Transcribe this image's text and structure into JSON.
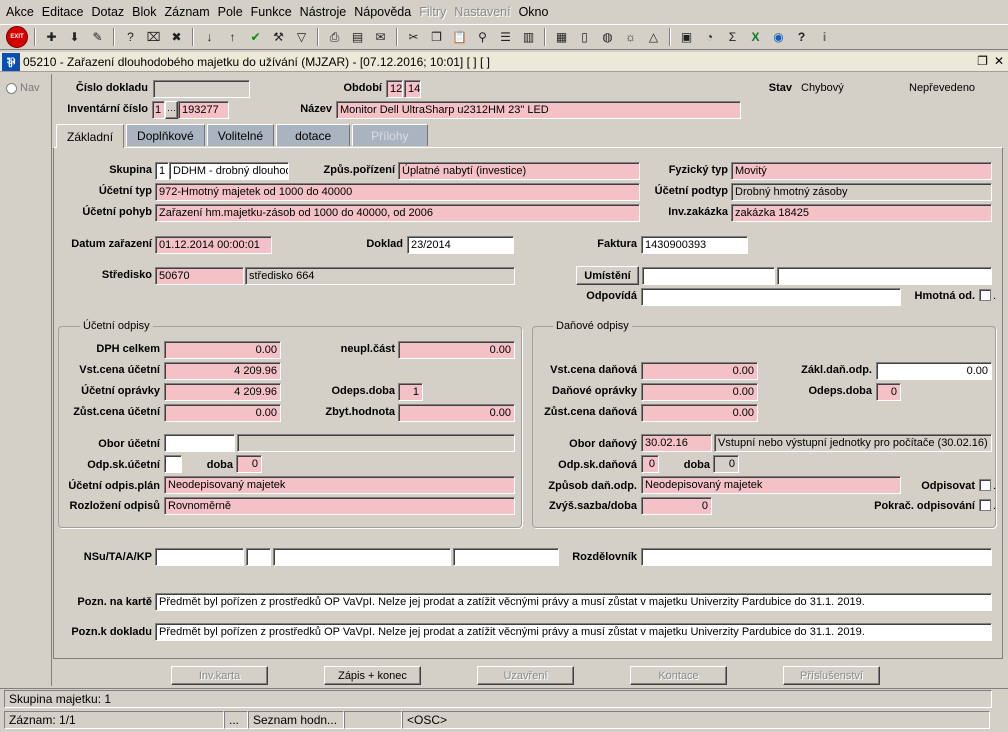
{
  "menu": [
    "Akce",
    "Editace",
    "Dotaz",
    "Blok",
    "Záznam",
    "Pole",
    "Funkce",
    "Nástroje",
    "Nápověda",
    "Filtry",
    "Nastavení",
    "Okno"
  ],
  "menu_disabled": [
    "Filtry",
    "Nastavení"
  ],
  "toolbar_icons": [
    "exit-icon",
    "add-record-icon",
    "save-icon",
    "erase-icon",
    "query-icon",
    "clear-query-icon",
    "delete-record-icon",
    "sort-asc-icon",
    "sort-desc-icon",
    "checkmark-icon",
    "wrench-icon",
    "filter-icon",
    "print-icon",
    "print-preview-icon",
    "mail-icon",
    "cut-icon",
    "copy-icon",
    "paste-icon",
    "zoom-icon",
    "list-icon",
    "columns-icon",
    "report-icon",
    "document-icon",
    "globe-icon",
    "sun-icon",
    "chart-icon",
    "calculator-icon",
    "report-edit-icon",
    "sum-icon",
    "excel-icon",
    "world-icon",
    "help-icon",
    "info-icon"
  ],
  "window": {
    "title": "05210 - Zařazení dlouhodobého majetku do užívání (MJZAR) - [07.12.2016; 10:01] [ ] [ ]"
  },
  "nav": {
    "label": "Nav"
  },
  "header": {
    "cislo_dokladu_label": "Číslo dokladu",
    "cislo_dokladu": "",
    "obdobi_label": "Období",
    "obdobi_1": "12",
    "obdobi_2": "14",
    "stav_label": "Stav",
    "stav": "Chybový",
    "neprevedeno": "Nepřevedeno",
    "inv_cislo_label": "Inventární číslo",
    "inv_cislo_1": "1",
    "inv_cislo_dots": "···",
    "inv_cislo_2": "193277",
    "nazev_label": "Název",
    "nazev": "Monitor Dell UltraSharp u2312HM 23\" LED"
  },
  "tabs": [
    {
      "label": "Základní",
      "state": "active"
    },
    {
      "label": "Doplňkové",
      "state": "inactive"
    },
    {
      "label": "Volitelné",
      "state": "inactive"
    },
    {
      "label": "dotace",
      "state": "inactive"
    },
    {
      "label": "Přílohy",
      "state": "disabled"
    }
  ],
  "main": {
    "skupina_label": "Skupina",
    "skupina_code": "1",
    "skupina_name": "DDHM - drobný dlouhod",
    "zpus_porizeni_label": "Způs.pořízení",
    "zpus_porizeni": "Úplatné nabytí (investice)",
    "fyzicky_typ_label": "Fyzický typ",
    "fyzicky_typ": "Movitý",
    "ucetni_typ_label": "Účetní typ",
    "ucetni_typ": "972-Hmotný majetek od 1000 do 40000",
    "ucetni_podtyp_label": "Účetní podtyp",
    "ucetni_podtyp": "Drobný hmotný zásoby",
    "ucetni_pohyb_label": "Účetní pohyb",
    "ucetni_pohyb": "Zařazení hm.majetku-zásob od 1000 do 40000, od 2006",
    "inv_zakazka_label": "Inv.zakázka",
    "inv_zakazka": "zakázka 18425",
    "datum_zarazeni_label": "Datum zařazení",
    "datum_zarazeni": "01.12.2014 00:00:01",
    "doklad_label": "Doklad",
    "doklad": "23/2014",
    "faktura_label": "Faktura",
    "faktura": "1430900393",
    "stredisko_label": "Středisko",
    "stredisko_code": "50670",
    "stredisko_name": "středisko 664",
    "umisteni_button": "Umístění",
    "umisteni_1": "",
    "umisteni_2": "",
    "odpovida_label": "Odpovídá",
    "odpovida": "",
    "hmotna_od_label": "Hmotná od."
  },
  "ucetni_odpisy": {
    "title": "Účetní odpisy",
    "dph_celkem_label": "DPH celkem",
    "dph_celkem": "0.00",
    "neupl_cast_label": "neupl.část",
    "neupl_cast": "0.00",
    "vst_cena_label": "Vst.cena účetní",
    "vst_cena": "4 209.96",
    "ucetni_opravky_label": "Účetní oprávky",
    "ucetni_opravky": "4 209.96",
    "odeps_doba_label": "Odeps.doba",
    "odeps_doba": "1",
    "zust_cena_label": "Zůst.cena účetní",
    "zust_cena": "0.00",
    "zbyt_hodnota_label": "Zbyt.hodnota",
    "zbyt_hodnota": "0.00",
    "obor_label": "Obor účetní",
    "obor_code": "",
    "obor_name": "",
    "odp_sk_label": "Odp.sk.účetní",
    "odp_sk": "",
    "doba_label": "doba",
    "doba": "0",
    "plan_label": "Účetní odpis.plán",
    "plan": "Neodepisovaný majetek",
    "rozlozeni_label": "Rozložení odpisů",
    "rozlozeni": "Rovnoměrně"
  },
  "danove_odpisy": {
    "title": "Daňové odpisy",
    "vst_cena_label": "Vst.cena daňová",
    "vst_cena": "0.00",
    "zakl_dan_label": "Zákl.daň.odp.",
    "zakl_dan": "0.00",
    "danove_opravky_label": "Daňové oprávky",
    "danove_opravky": "0.00",
    "odeps_doba_label": "Odeps.doba",
    "odeps_doba": "0",
    "zust_cena_label": "Zůst.cena daňová",
    "zust_cena": "0.00",
    "obor_label": "Obor daňový",
    "obor_code": "30.02.16",
    "obor_name": "Vstupní nebo výstupní jednotky pro počítače (30.02.16)",
    "odp_sk_label": "Odp.sk.daňová",
    "odp_sk": "0",
    "doba_label": "doba",
    "doba": "0",
    "zpusob_label": "Způsob daň.odp.",
    "zpusob": "Neodepisovaný majetek",
    "odpisovat_label": "Odpisovat",
    "zvys_sazba_label": "Zvýš.sazba/doba",
    "zvys_sazba": "0",
    "pokrac_label": "Pokrač. odpisování"
  },
  "footer": {
    "nsu_label": "NSu/TA/A/KP",
    "nsu_1": "",
    "nsu_2": "",
    "nsu_3": "",
    "nsu_4": "",
    "rozdelovnik_label": "Rozdělovník",
    "rozdelovnik": "",
    "pozn_karte_label": "Pozn. na kartě",
    "pozn_karte": "Předmět byl pořízen z prostředků OP VaVpI. Nelze jej prodat a zatížit věcnými právy a musí zůstat v majetku Univerzity Pardubice do 31.1. 2019.",
    "pozn_dokladu_label": "Pozn.k dokladu",
    "pozn_dokladu": "Předmět byl pořízen z prostředků OP VaVpI. Nelze jej prodat a zatížit věcnými právy a musí zůstat v majetku Univerzity Pardubice do 31.1. 2019."
  },
  "buttons": {
    "inv_karta": "Inv.karta",
    "zapis_konec": "Zápis + konec",
    "uzavreni": "Uzavření",
    "kontace": "Kontace",
    "prislusenstvi": "Příslušenství"
  },
  "status": {
    "line1": "Skupina majetku: 1",
    "zaznam": "Záznam: 1/1",
    "seg2": "...",
    "seg3": "Seznam hodn...",
    "seg4": "",
    "seg5": "<OSC>"
  }
}
